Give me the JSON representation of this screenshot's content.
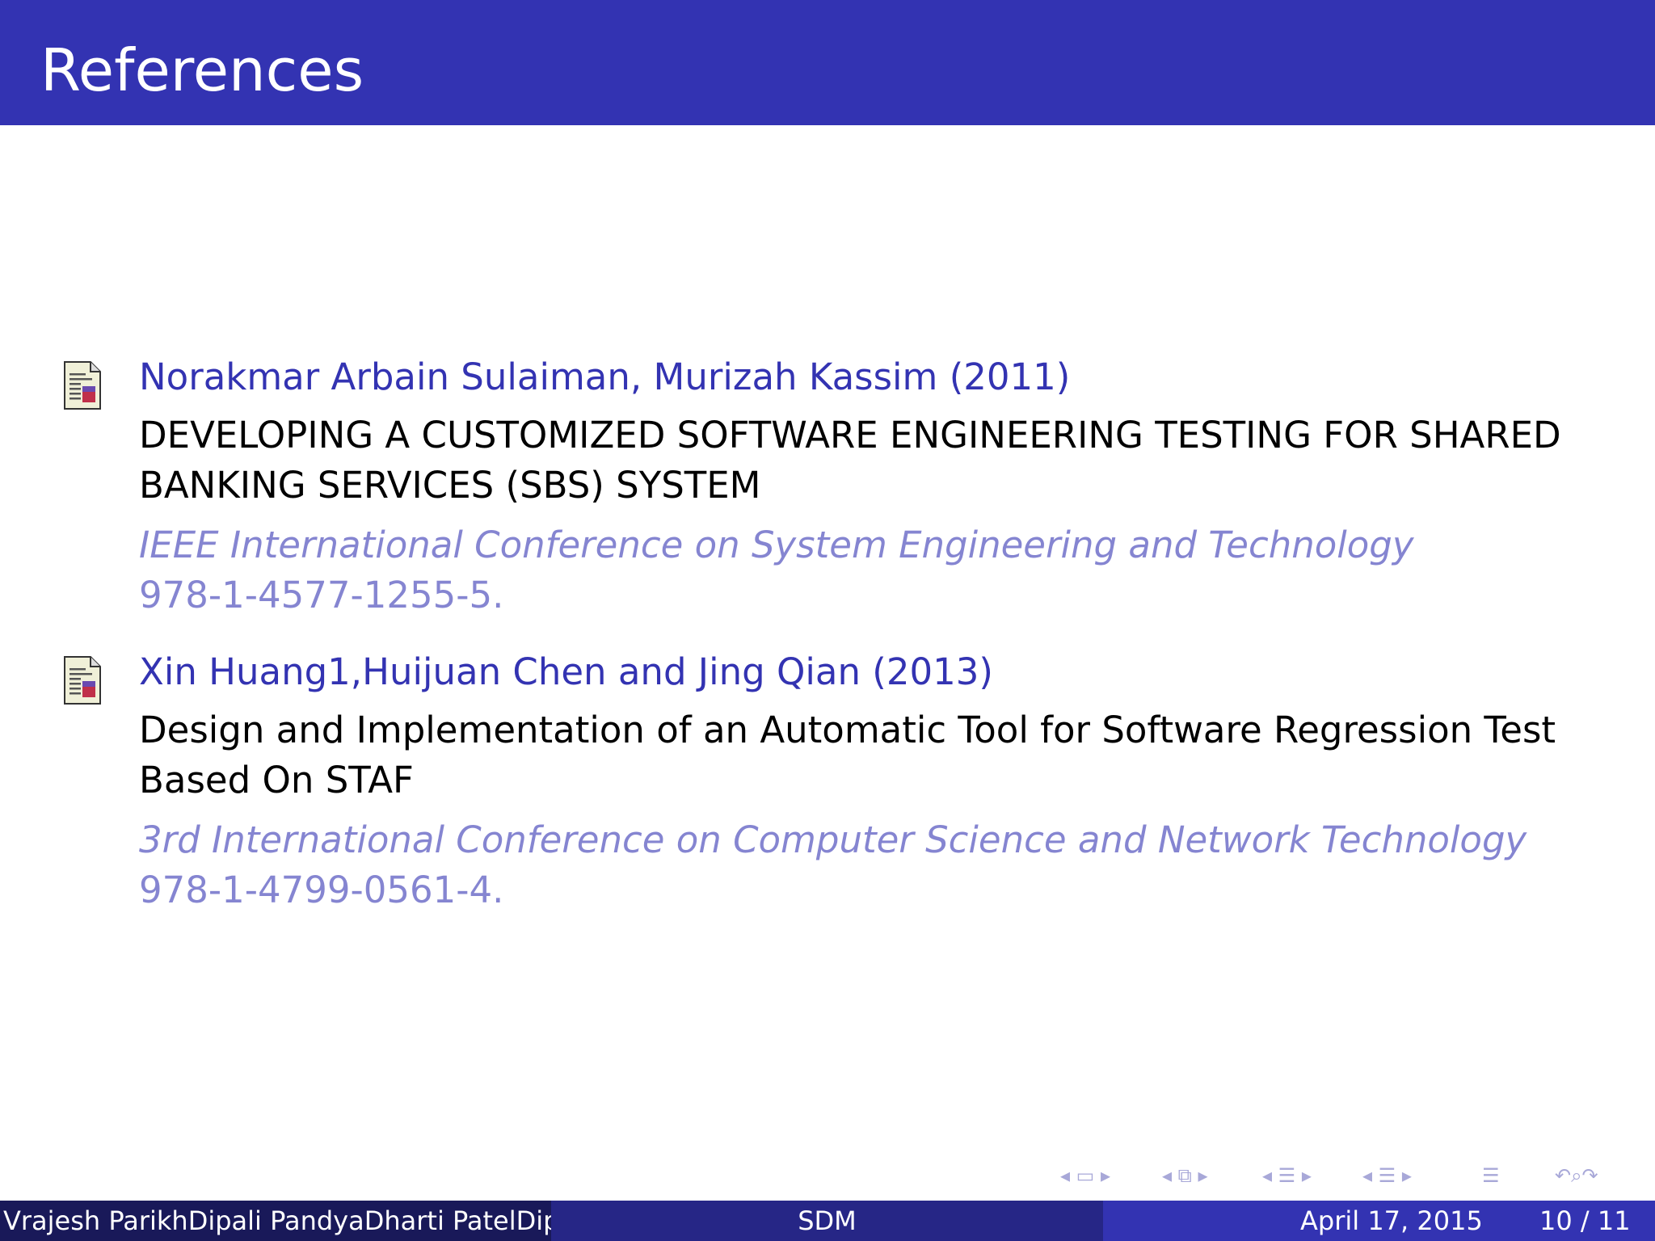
{
  "header": {
    "title": "References"
  },
  "references": [
    {
      "author": "Norakmar Arbain Sulaiman, Murizah Kassim (2011)",
      "title": "DEVELOPING A CUSTOMIZED SOFTWARE ENGINEERING TESTING FOR SHARED BANKING SERVICES (SBS) SYSTEM",
      "venue": "IEEE International Conference on System Engineering and Technology",
      "isbn": "978-1-4577-1255-5."
    },
    {
      "author": "Xin Huang1,Huijuan Chen and Jing Qian (2013)",
      "title": "Design and Implementation of an Automatic Tool for Software Regression Test Based On STAF",
      "venue": "3rd International Conference on Computer Science and Network Technology",
      "isbn": "978-1-4799-0561-4."
    }
  ],
  "icons": {
    "reference": "article-icon",
    "navigation": [
      "nav-frame-icon",
      "nav-subsection-icon",
      "nav-section-icon",
      "nav-presentation-icon",
      "nav-align-icon",
      "nav-search-icon"
    ]
  },
  "footer": {
    "authors": "Vrajesh ParikhDipali PandyaDharti PatelDipti",
    "short_title": "SDM",
    "date": "April 17, 2015",
    "page": "10 / 11"
  },
  "colors": {
    "header": "#3333b2",
    "author_text": "#3333b2",
    "venue_text": "#8585d1",
    "footer_left": "#191959",
    "footer_mid": "#262686",
    "footer_right": "#3333b2"
  }
}
